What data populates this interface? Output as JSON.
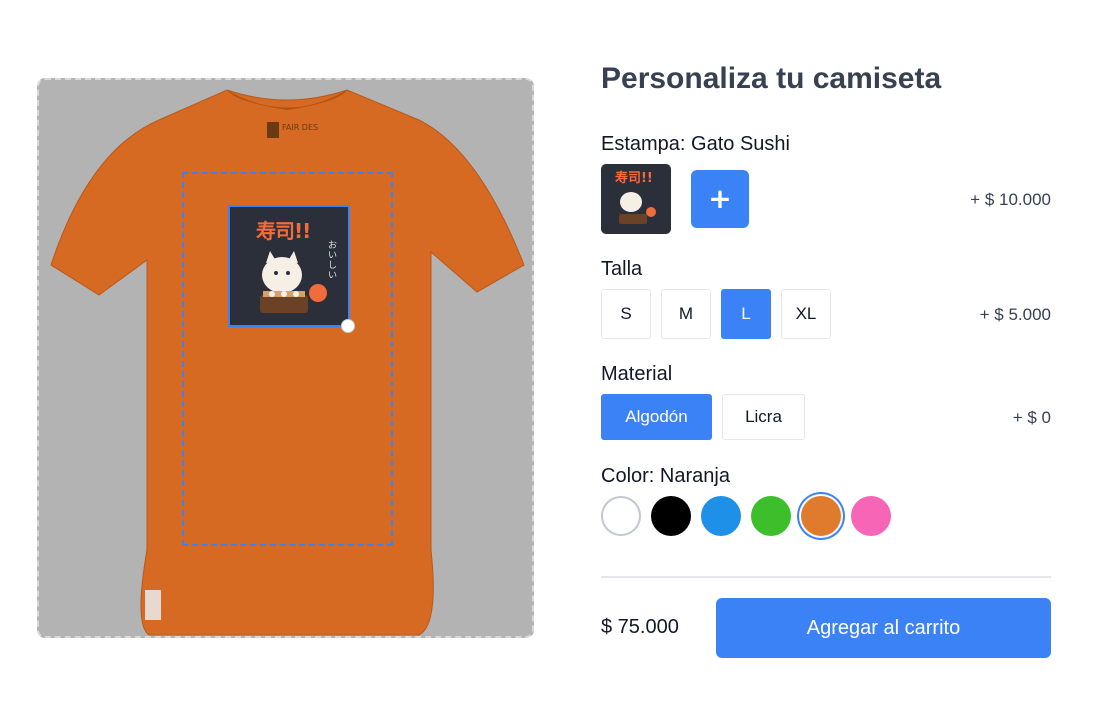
{
  "header": {
    "title": "Personaliza tu camiseta"
  },
  "preview": {
    "shirt_color": "#e07b2e",
    "brand_tag": "FAIR DES",
    "design_kanji": "寿司!!",
    "design_sub": "おいしい"
  },
  "print": {
    "label": "Estampa: Gato Sushi",
    "add_label": "+",
    "price": "+ $ 10.000"
  },
  "size": {
    "label": "Talla",
    "options": [
      "S",
      "M",
      "L",
      "XL"
    ],
    "selected": "L",
    "price": "+ $ 5.000"
  },
  "material": {
    "label": "Material",
    "options": [
      "Algodón",
      "Licra"
    ],
    "selected": "Algodón",
    "price": "+ $ 0"
  },
  "color": {
    "label": "Color: Naranja",
    "swatches": [
      {
        "name": "white",
        "hex": "#ffffff"
      },
      {
        "name": "black",
        "hex": "#000000"
      },
      {
        "name": "blue",
        "hex": "#1e90e8"
      },
      {
        "name": "green",
        "hex": "#3cbf2a"
      },
      {
        "name": "orange",
        "hex": "#e07b2e"
      },
      {
        "name": "pink",
        "hex": "#f765b6"
      }
    ],
    "selected": "orange"
  },
  "footer": {
    "total": "$ 75.000",
    "cart_label": "Agregar al carrito"
  },
  "theme": {
    "accent": "#3b82f6"
  }
}
